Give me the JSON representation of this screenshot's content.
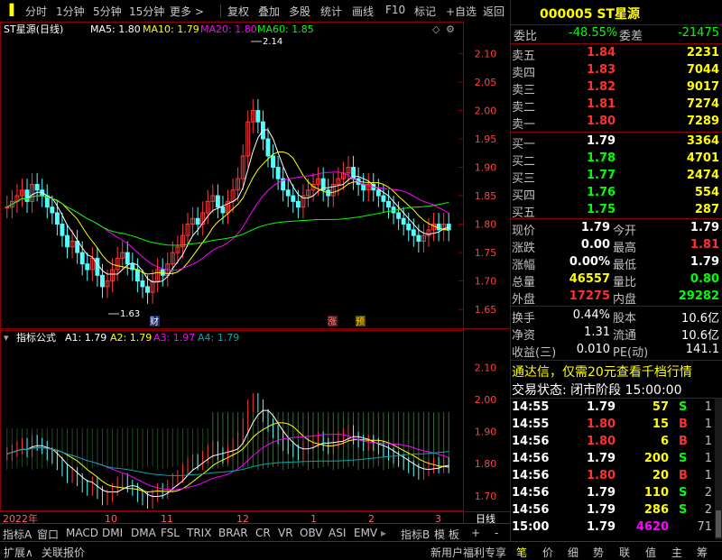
{
  "toolbar": {
    "items": [
      "分时",
      "1分钟",
      "5分钟",
      "15分钟",
      "更多 >",
      "复权",
      "叠加",
      "多股",
      "统计",
      "画线",
      "F10",
      "标记",
      "+自选",
      "返回"
    ]
  },
  "chart": {
    "title": "ST星源(日线)",
    "ma_labels": [
      {
        "text": "MA5: 1.80",
        "color": "#ffffff"
      },
      {
        "text": "MA10: 1.79",
        "color": "#ffff00"
      },
      {
        "text": "MA20: 1.80",
        "color": "#ff00ff"
      },
      {
        "text": "MA60: 1.85",
        "color": "#00ff00"
      }
    ],
    "y_ticks": [
      "2.10",
      "2.05",
      "2.00",
      "1.95",
      "1.90",
      "1.85",
      "1.80",
      "1.75",
      "1.70",
      "1.65"
    ],
    "high_marker": "2.14",
    "low_marker": "1.63",
    "badges": {
      "cai": "财",
      "zhang": "涨",
      "yu": "预"
    },
    "indicator_title": "指标公式",
    "indicator_labels": [
      {
        "text": "A1: 1.79",
        "color": "#ffffff"
      },
      {
        "text": "A2: 1.79",
        "color": "#ffff00"
      },
      {
        "text": "A3: 1.97",
        "color": "#ff00ff"
      },
      {
        "text": "A4: 1.79",
        "color": "#00aaaa"
      }
    ],
    "ind_ticks": [
      "2.10",
      "2.00",
      "1.90",
      "1.80",
      "1.70"
    ],
    "x_labels": {
      "year": "2022年",
      "m10": "10",
      "m11": "11",
      "m12": "12",
      "m1": "1",
      "m2": "2",
      "m3": "3",
      "period": "日线"
    }
  },
  "chart_data": {
    "type": "candlestick",
    "title": "ST星源(日线)",
    "ylim": [
      1.62,
      2.15
    ],
    "ma": {
      "MA5": 1.8,
      "MA10": 1.79,
      "MA20": 1.8,
      "MA60": 1.85
    },
    "high": 2.14,
    "low": 1.63,
    "indicator": {
      "A1": 1.79,
      "A2": 1.79,
      "A3": 1.97,
      "A4": 1.79
    }
  },
  "tabs": [
    "指标A",
    "窗口",
    "MACD",
    "DMI",
    "DMA",
    "FSL",
    "TRIX",
    "BRAR",
    "CR",
    "VR",
    "OBV",
    "ASI",
    "EMV",
    "指标B",
    "模 板",
    "+",
    "-"
  ],
  "bottom": {
    "left1": "扩展∧",
    "left2": "关联报价",
    "promo": "新用户福利专享",
    "nav": [
      "笔",
      "价",
      "细",
      "势",
      "联",
      "值",
      "主",
      "筹"
    ]
  },
  "quote": {
    "code_name": "000005 ST星源",
    "weibi_label": "委比",
    "weibi": "-48.55%",
    "weicha_label": "委差",
    "weicha": "-21475",
    "asks": [
      {
        "label": "卖五",
        "price": "1.84",
        "vol": "2231"
      },
      {
        "label": "卖四",
        "price": "1.83",
        "vol": "7044"
      },
      {
        "label": "卖三",
        "price": "1.82",
        "vol": "9017"
      },
      {
        "label": "卖二",
        "price": "1.81",
        "vol": "7274"
      },
      {
        "label": "卖一",
        "price": "1.80",
        "vol": "7289"
      }
    ],
    "bids": [
      {
        "label": "买一",
        "price": "1.79",
        "vol": "3364"
      },
      {
        "label": "买二",
        "price": "1.78",
        "vol": "4701"
      },
      {
        "label": "买三",
        "price": "1.77",
        "vol": "2474"
      },
      {
        "label": "买四",
        "price": "1.76",
        "vol": "554"
      },
      {
        "label": "买五",
        "price": "1.75",
        "vol": "287"
      }
    ],
    "stats": [
      {
        "l1": "现价",
        "v1": "1.79",
        "l2": "今开",
        "v2": "1.79",
        "c2": "#ffffff"
      },
      {
        "l1": "涨跌",
        "v1": "0.00",
        "l2": "最高",
        "v2": "1.81",
        "c2": "#ff3030"
      },
      {
        "l1": "涨幅",
        "v1": "0.00%",
        "l2": "最低",
        "v2": "1.79",
        "c2": "#ffffff"
      },
      {
        "l1": "总量",
        "v1": "46557",
        "l2": "量比",
        "v2": "0.80",
        "c2": "#00ff00",
        "c1": "#ffff00"
      },
      {
        "l1": "外盘",
        "v1": "17275",
        "l2": "内盘",
        "v2": "29282",
        "c2": "#00ff00",
        "c1": "#ff3030"
      }
    ],
    "stats2": [
      {
        "l1": "换手",
        "v1": "0.44%",
        "l2": "股本",
        "v2": "10.6亿"
      },
      {
        "l1": "净资",
        "v1": "1.31",
        "l2": "流通",
        "v2": "10.6亿"
      },
      {
        "l1": "收益(三)",
        "v1": "0.010",
        "l2": "PE(动)",
        "v2": "141.1"
      }
    ],
    "promo": "通达信，仅需20元查看千档行情",
    "status": "交易状态: 闭市阶段 15:00:00",
    "ticks": [
      {
        "t": "14:55",
        "p": "1.79",
        "pc": "#ffffff",
        "v": "57",
        "vc": "#ffff00",
        "s": "S",
        "sc": "#00ff00",
        "n": "1"
      },
      {
        "t": "14:55",
        "p": "1.80",
        "pc": "#ff3030",
        "v": "15",
        "vc": "#ffff00",
        "s": "B",
        "sc": "#ff3030",
        "n": "1"
      },
      {
        "t": "14:56",
        "p": "1.80",
        "pc": "#ff3030",
        "v": "6",
        "vc": "#ffff00",
        "s": "B",
        "sc": "#ff3030",
        "n": "1"
      },
      {
        "t": "14:56",
        "p": "1.79",
        "pc": "#ffffff",
        "v": "200",
        "vc": "#ffff00",
        "s": "S",
        "sc": "#00ff00",
        "n": "1"
      },
      {
        "t": "14:56",
        "p": "1.80",
        "pc": "#ff3030",
        "v": "20",
        "vc": "#ffff00",
        "s": "B",
        "sc": "#ff3030",
        "n": "1"
      },
      {
        "t": "14:56",
        "p": "1.79",
        "pc": "#ffffff",
        "v": "110",
        "vc": "#ffff00",
        "s": "S",
        "sc": "#00ff00",
        "n": "2"
      },
      {
        "t": "14:56",
        "p": "1.79",
        "pc": "#ffffff",
        "v": "286",
        "vc": "#ffff00",
        "s": "S",
        "sc": "#00ff00",
        "n": "2"
      },
      {
        "t": "15:00",
        "p": "1.79",
        "pc": "#ffffff",
        "v": "4620",
        "vc": "#ff00ff",
        "s": "",
        "sc": "#ffffff",
        "n": "71"
      }
    ]
  }
}
